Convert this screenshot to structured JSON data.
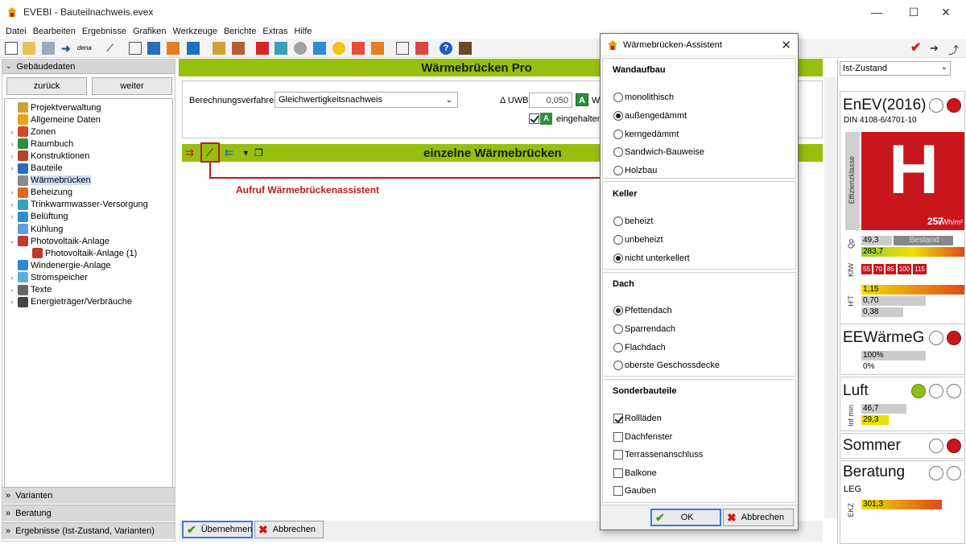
{
  "window": {
    "title": "EVEBI - Bauteilnachweis.evex"
  },
  "menu": [
    "Datei",
    "Bearbeiten",
    "Ergebnisse",
    "Grafiken",
    "Werkzeuge",
    "Berichte",
    "Extras",
    "Hilfe"
  ],
  "toolbar": {
    "dena_label": "dena"
  },
  "left": {
    "header": "Gebäudedaten",
    "back": "zurück",
    "next": "weiter",
    "tree": [
      {
        "label": "Projektverwaltung",
        "indent": 0,
        "arrow": ""
      },
      {
        "label": "Allgemeine Daten",
        "indent": 0,
        "arrow": ""
      },
      {
        "label": "Zonen",
        "indent": 0,
        "arrow": "›"
      },
      {
        "label": "Raumbuch",
        "indent": 0,
        "arrow": "›"
      },
      {
        "label": "Konstruktionen",
        "indent": 0,
        "arrow": "›"
      },
      {
        "label": "Bauteile",
        "indent": 0,
        "arrow": "›"
      },
      {
        "label": "Wärmebrücken",
        "indent": 0,
        "arrow": "",
        "selected": true
      },
      {
        "label": "Beheizung",
        "indent": 0,
        "arrow": "›"
      },
      {
        "label": "Trinkwarmwasser-Versorgung",
        "indent": 0,
        "arrow": "›"
      },
      {
        "label": "Belüftung",
        "indent": 0,
        "arrow": "›"
      },
      {
        "label": "Kühlung",
        "indent": 0,
        "arrow": ""
      },
      {
        "label": "Photovoltaik-Anlage",
        "indent": 0,
        "arrow": "⌄"
      },
      {
        "label": "Photovoltaik-Anlage (1)",
        "indent": 1,
        "arrow": ""
      },
      {
        "label": "Windenergie-Anlage",
        "indent": 0,
        "arrow": ""
      },
      {
        "label": "Stromspeicher",
        "indent": 0,
        "arrow": "›"
      },
      {
        "label": "Texte",
        "indent": 0,
        "arrow": "›"
      },
      {
        "label": "Energieträger/Verbräuche",
        "indent": 0,
        "arrow": "›"
      }
    ],
    "bottom": [
      "Varianten",
      "Beratung",
      "Ergebnisse (Ist-Zustand, Varianten)"
    ]
  },
  "main": {
    "title": "Wärmebrücken Pro",
    "calc_label": "Berechnungsverfahren",
    "calc_value": "Gleichwertigkeitsnachweis",
    "uwb_label": "Δ UWB",
    "uwb_value": "0,050",
    "uwb_unit": "W/",
    "a_badge": "A",
    "check_label": "eingehalten",
    "sub_title": "einzelne Wärmebrücken",
    "callout": "Aufruf Wärmebrückenassistent",
    "ok_button": "Übernehmen",
    "cancel_button": "Abbrechen"
  },
  "right": {
    "state": "Ist-Zustand",
    "enev": "EnEV(2016)",
    "din": "DIN 4108-6/4701-10",
    "effizienz": "Effizienzklasse",
    "grade": "H",
    "kwh": "257",
    "kwh_unit": "kWh/m²",
    "qp_label": "Qp",
    "qp1": "49,3",
    "bestand": "Bestand",
    "qp2": "283,7",
    "kfw_label": "KfW",
    "kfw": [
      "55",
      "70",
      "85",
      "100",
      "115"
    ],
    "ht_label": "H'T",
    "ht": [
      "1,15",
      "0,70",
      "0,38"
    ],
    "eew": "EEWärmeG",
    "eew1": "100%",
    "eew2": "0%",
    "luft": "Luft",
    "inf_label": "Inf min",
    "luft1": "46,7",
    "luft2": "29,3",
    "sommer": "Sommer",
    "beratung": "Beratung",
    "leg": "LEG",
    "ekz_label": "EKZ",
    "ekz": "301,3"
  },
  "dialog": {
    "title": "Wärmebrücken-Assistent",
    "groups": [
      {
        "title": "Wandaufbau",
        "type": "radio",
        "options": [
          {
            "label": "monolithisch",
            "on": false
          },
          {
            "label": "außengedämmt",
            "on": true
          },
          {
            "label": "kerngedämmt",
            "on": false
          },
          {
            "label": "Sandwich-Bauweise",
            "on": false
          },
          {
            "label": "Holzbau",
            "on": false
          }
        ]
      },
      {
        "title": "Keller",
        "type": "radio",
        "options": [
          {
            "label": "beheizt",
            "on": false
          },
          {
            "label": "unbeheizt",
            "on": false
          },
          {
            "label": "nicht unterkellert",
            "on": true
          }
        ]
      },
      {
        "title": "Dach",
        "type": "radio",
        "options": [
          {
            "label": "Pfettendach",
            "on": true
          },
          {
            "label": "Sparrendach",
            "on": false
          },
          {
            "label": "Flachdach",
            "on": false
          },
          {
            "label": "oberste Geschossdecke",
            "on": false
          }
        ]
      },
      {
        "title": "Sonderbauteile",
        "type": "check",
        "options": [
          {
            "label": "Rollläden",
            "on": true
          },
          {
            "label": "Dachfenster",
            "on": false
          },
          {
            "label": "Terrassenanschluss",
            "on": false
          },
          {
            "label": "Balkone",
            "on": false
          },
          {
            "label": "Gauben",
            "on": false
          }
        ]
      }
    ],
    "ok": "OK",
    "cancel": "Abbrechen"
  },
  "colors": {
    "accent_green": "#97bf0d",
    "red": "#c9161c",
    "callout": "#c01818"
  }
}
